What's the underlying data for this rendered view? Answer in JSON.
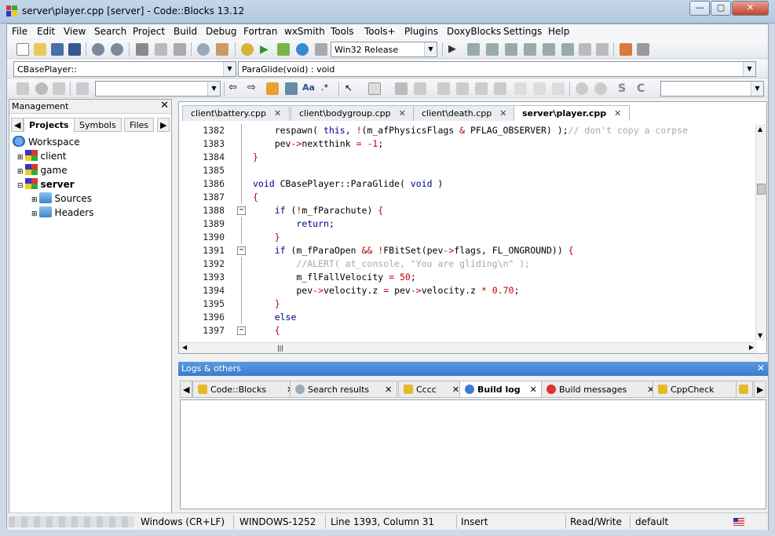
{
  "window": {
    "title": "server\\player.cpp [server] - Code::Blocks 13.12",
    "buttons": [
      "—",
      "▢",
      "✕"
    ]
  },
  "menu": [
    "File",
    "Edit",
    "View",
    "Search",
    "Project",
    "Build",
    "Debug",
    "Fortran",
    "wxSmith",
    "Tools",
    "Tools+",
    "Plugins",
    "DoxyBlocks",
    "Settings",
    "Help"
  ],
  "toolbar": {
    "build_target": "Win32 Release"
  },
  "code_toolbar": {
    "scope": "CBasePlayer::",
    "function": "ParaGlide(void) : void"
  },
  "management": {
    "title": "Management",
    "tabs": [
      "Projects",
      "Symbols",
      "Files"
    ],
    "tree": [
      {
        "label": "Workspace",
        "level": 0,
        "icon": "workspace-icon"
      },
      {
        "label": "client",
        "level": 1,
        "icon": "project-icon"
      },
      {
        "label": "game",
        "level": 1,
        "icon": "project-icon"
      },
      {
        "label": "server",
        "level": 1,
        "icon": "project-icon",
        "bold": true
      },
      {
        "label": "Sources",
        "level": 2,
        "icon": "folder-icon"
      },
      {
        "label": "Headers",
        "level": 2,
        "icon": "folder-icon"
      }
    ]
  },
  "editor": {
    "tabs": [
      {
        "label": "client\\battery.cpp",
        "active": false
      },
      {
        "label": "client\\bodygroup.cpp",
        "active": false
      },
      {
        "label": "client\\death.cpp",
        "active": false
      },
      {
        "label": "server\\player.cpp",
        "active": true
      }
    ],
    "lines": [
      {
        "n": "1382",
        "html": "    respawn( <span class='kw'>this</span>, <span class='op'>!</span>(m_afPhysicsFlags <span class='op'>&amp;</span> PFLAG_OBSERVER) );<span class='cm'>// don't copy a corpse</span>"
      },
      {
        "n": "1383",
        "html": "    pev<span class='op'>-&gt;</span>nextthink <span class='op'>=</span> <span class='num'>-1</span>;"
      },
      {
        "n": "1384",
        "html": "<span class='op'>}</span>"
      },
      {
        "n": "1385",
        "html": ""
      },
      {
        "n": "1386",
        "html": "<span class='kw'>void</span> CBasePlayer::ParaGlide( <span class='kw'>void</span> )"
      },
      {
        "n": "1387",
        "html": "<span class='op'>{</span>"
      },
      {
        "n": "1388",
        "html": "    <span class='kw'>if</span> (<span class='op'>!</span>m_fParachute) <span class='op'>{</span>"
      },
      {
        "n": "1389",
        "html": "        <span class='kw'>return</span>;"
      },
      {
        "n": "1390",
        "html": "    <span class='op'>}</span>"
      },
      {
        "n": "1391",
        "html": "    <span class='kw'>if</span> (m_fParaOpen <span class='op'>&amp;&amp;</span> <span class='op'>!</span>FBitSet(pev<span class='op'>-&gt;</span>flags, FL_ONGROUND)) <span class='op'>{</span>"
      },
      {
        "n": "1392",
        "html": "        <span class='cm'>//ALERT( at_console, \"You are gliding\\n\" );</span>"
      },
      {
        "n": "1393",
        "html": "        m_flFallVelocity <span class='op'>=</span> <span class='num'>50</span>;"
      },
      {
        "n": "1394",
        "html": "        pev<span class='op'>-&gt;</span>velocity.z <span class='op'>=</span> pev<span class='op'>-&gt;</span>velocity.z <span class='op'>*</span> <span class='num'>0.70</span>;"
      },
      {
        "n": "1395",
        "html": "    <span class='op'>}</span>"
      },
      {
        "n": "1396",
        "html": "    <span class='kw'>else</span>"
      },
      {
        "n": "1397",
        "html": "    <span class='op'>{</span>"
      }
    ]
  },
  "logs": {
    "title": "Logs & others",
    "tabs": [
      {
        "label": "Code::Blocks",
        "icon": "pencil-icon"
      },
      {
        "label": "Search results",
        "icon": "search-icon"
      },
      {
        "label": "Cccc",
        "icon": "pencil-icon"
      },
      {
        "label": "Build log",
        "icon": "gear-icon",
        "active": true
      },
      {
        "label": "Build messages",
        "icon": "pin-icon"
      },
      {
        "label": "CppCheck",
        "icon": "pencil-icon"
      }
    ]
  },
  "status": {
    "eol": "Windows (CR+LF)",
    "encoding": "WINDOWS-1252",
    "position": "Line 1393, Column 31",
    "mode": "Insert",
    "access": "Read/Write",
    "lang": "default"
  }
}
